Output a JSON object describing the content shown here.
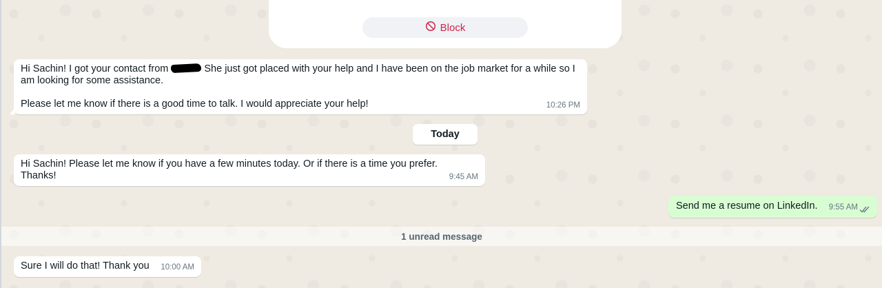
{
  "block_card": {
    "button_label": "Block",
    "icon": "block-icon",
    "accent_color": "#d1244a"
  },
  "messages": [
    {
      "direction": "incoming",
      "text_before_redaction": "Hi Sachin! I got your contact from",
      "text_after_redaction": "She just got placed with your help and I have been on the job market for a while so I am looking for some assistance.\n\nPlease let me know if there is a good time to talk. I would appreciate your help!",
      "time": "10:26 PM"
    },
    {
      "direction": "incoming",
      "text": "Hi Sachin! Please let me know if you have a few minutes today. Or if there is a time you prefer.\nThanks!",
      "time": "9:45 AM"
    },
    {
      "direction": "outgoing",
      "text": "Send me a resume on LinkedIn.",
      "time": "9:55 AM",
      "status_icon": "double-check-icon"
    },
    {
      "direction": "incoming",
      "text": "Sure I will do that! Thank you",
      "time": "10:00 AM"
    }
  ],
  "date_separator": "Today",
  "unread_banner": "1 unread message",
  "colors": {
    "background": "#efeae2",
    "incoming_bubble": "#ffffff",
    "outgoing_bubble": "#d9fdd3",
    "timestamp": "#667781"
  }
}
